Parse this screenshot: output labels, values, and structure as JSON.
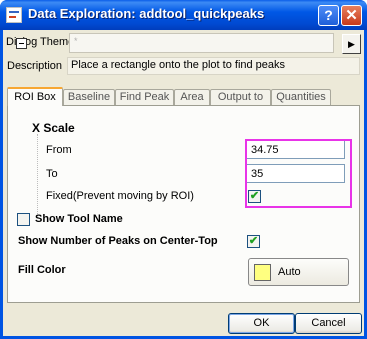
{
  "window": {
    "title": "Data Exploration: addtool_quickpeaks",
    "help_glyph": "?",
    "close_glyph": "✕"
  },
  "theme": {
    "label": "Dialog Theme",
    "value": "*",
    "arrow_glyph": "▶"
  },
  "description": {
    "label": "Description",
    "text": "Place a rectangle onto the plot to find peaks"
  },
  "tabs": [
    {
      "label": "ROI Box",
      "active": true
    },
    {
      "label": "Baseline"
    },
    {
      "label": "Find Peak"
    },
    {
      "label": "Area"
    },
    {
      "label": "Output to"
    },
    {
      "label": "Quantities"
    }
  ],
  "roi": {
    "x_scale_label": "X Scale",
    "from_label": "From",
    "from_value": "34.75",
    "to_label": "To",
    "to_value": "35",
    "fixed_label": "Fixed(Prevent moving by ROI)",
    "fixed_checked": true,
    "show_tool_name_label": "Show Tool Name",
    "show_tool_name_checked": false,
    "show_peaks_label": "Show Number of Peaks on Center-Top",
    "show_peaks_checked": true,
    "fill_color_label": "Fill Color",
    "fill_color_value": "Auto",
    "fill_color_swatch": "#ffff80"
  },
  "buttons": {
    "ok": "OK",
    "cancel": "Cancel"
  },
  "check_glyph": "✔",
  "colors": {
    "title_bar": "#0054e3",
    "highlight_box": "#e834e8",
    "active_tab_accent": "#f7a733"
  }
}
